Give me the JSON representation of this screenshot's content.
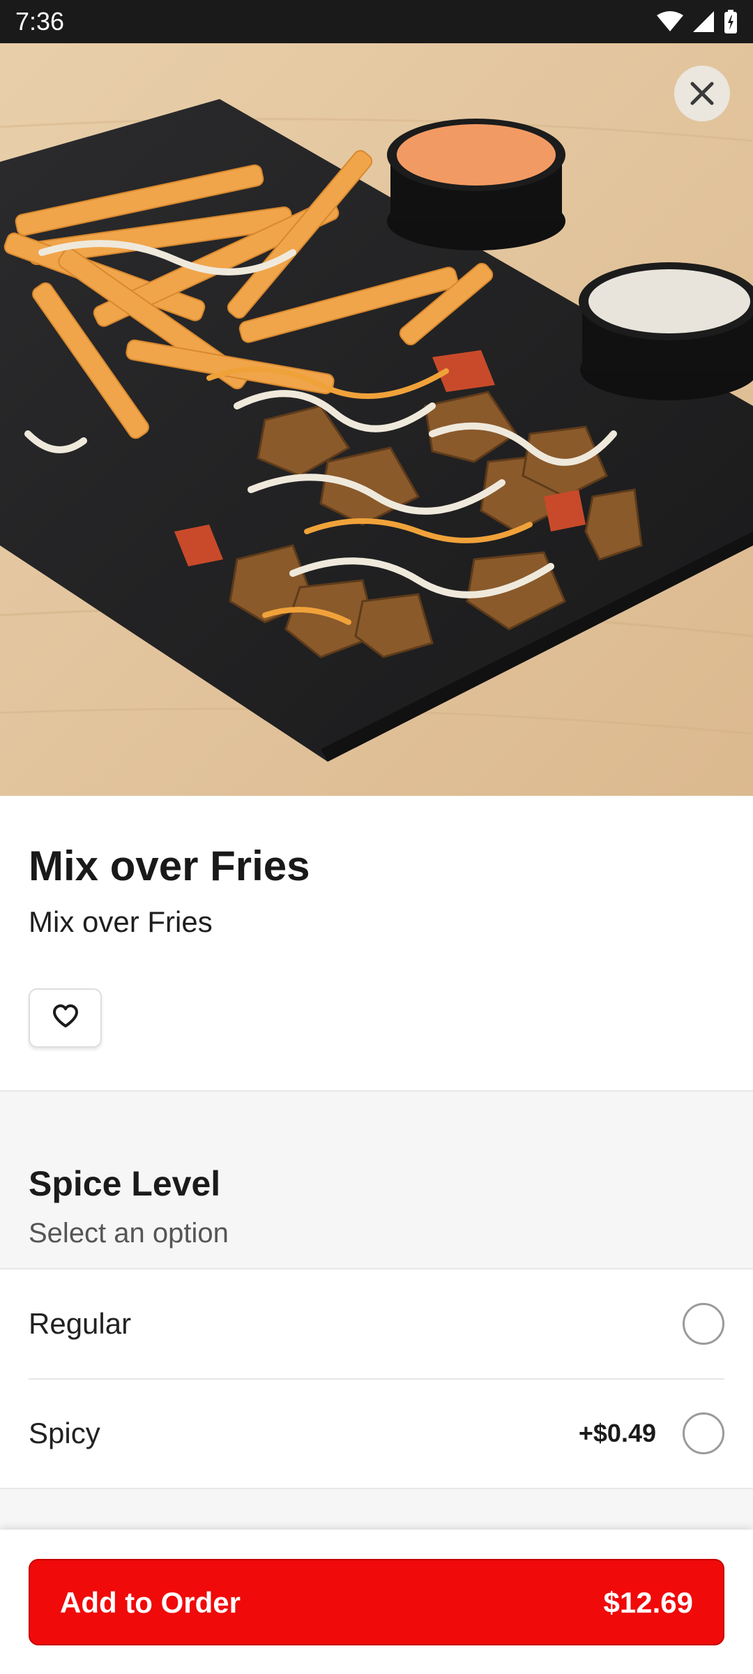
{
  "status_bar": {
    "time": "7:36"
  },
  "hero": {
    "image": "loaded-fries-with-meat-and-sauces-photo",
    "close_icon": "close-icon"
  },
  "item": {
    "title": "Mix over Fries",
    "description": "Mix over Fries",
    "favorite_icon": "heart-icon"
  },
  "option_group": {
    "title": "Spice Level",
    "subtitle": "Select an option",
    "options": [
      {
        "label": "Regular",
        "price": "",
        "selected": false
      },
      {
        "label": "Spicy",
        "price": "+$0.49",
        "selected": false
      }
    ]
  },
  "cta": {
    "label": "Add to Order",
    "price": "$12.69"
  },
  "colors": {
    "accent": "#f00a0a",
    "status_bar": "#1a1a1a",
    "section_bg": "#f6f6f6"
  }
}
